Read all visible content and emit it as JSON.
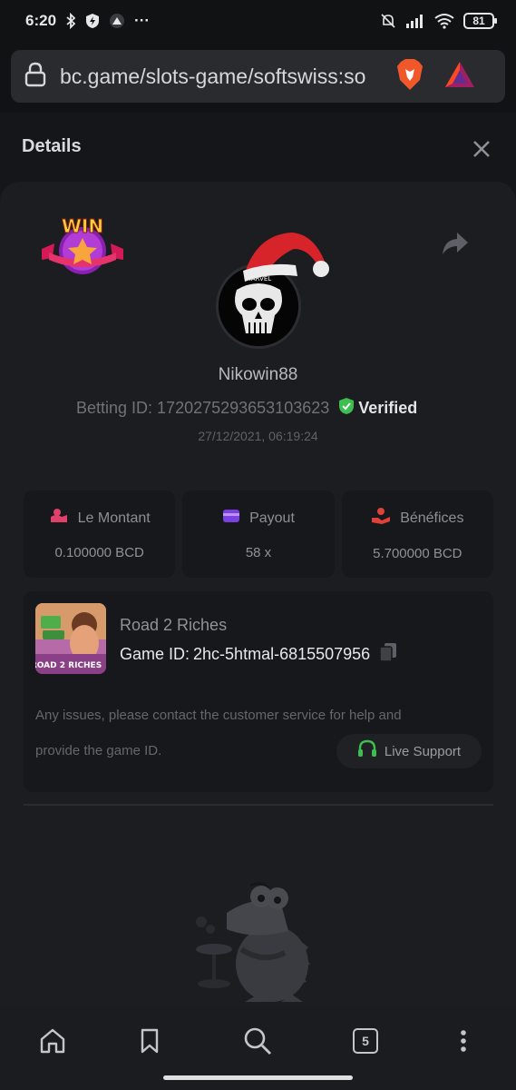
{
  "status_bar": {
    "time": "6:20",
    "battery": "81",
    "more": "···"
  },
  "browser": {
    "url": "bc.game/slots-game/softswiss:so",
    "tab_count": "5"
  },
  "details": {
    "title": "Details",
    "username": "Nikowin88",
    "betting_id": "Betting ID: 1720275293653103623",
    "verified_label": "Verified",
    "timestamp": "27/12/2021, 06:19:24",
    "badge_text": "WIN",
    "avatar_text": "MARVEL"
  },
  "stats": [
    {
      "label": "Le Montant",
      "value": "0.100000 BCD",
      "icon": "coins-icon",
      "color": "#e0416b"
    },
    {
      "label": "Payout",
      "value": "58 x",
      "icon": "card-icon",
      "color": "#7c3fe0"
    },
    {
      "label": "Bénéfices",
      "value": "5.700000 BCD",
      "icon": "profit-hand-icon",
      "color": "#e0413a"
    }
  ],
  "game": {
    "name": "Road 2 Riches",
    "id_label": "Game ID:",
    "id_value": "2hc-5htmal-6815507956",
    "thumb_text": "ROAD 2 RICHES",
    "help_line1": "Any issues, please contact the customer service for help and",
    "help_line2": "provide the game ID.",
    "support_label": "Live Support"
  },
  "colors": {
    "verified": "#3cbf4f",
    "support_icon": "#3cbf4f",
    "background": "#111214",
    "card": "#1c1d21"
  }
}
